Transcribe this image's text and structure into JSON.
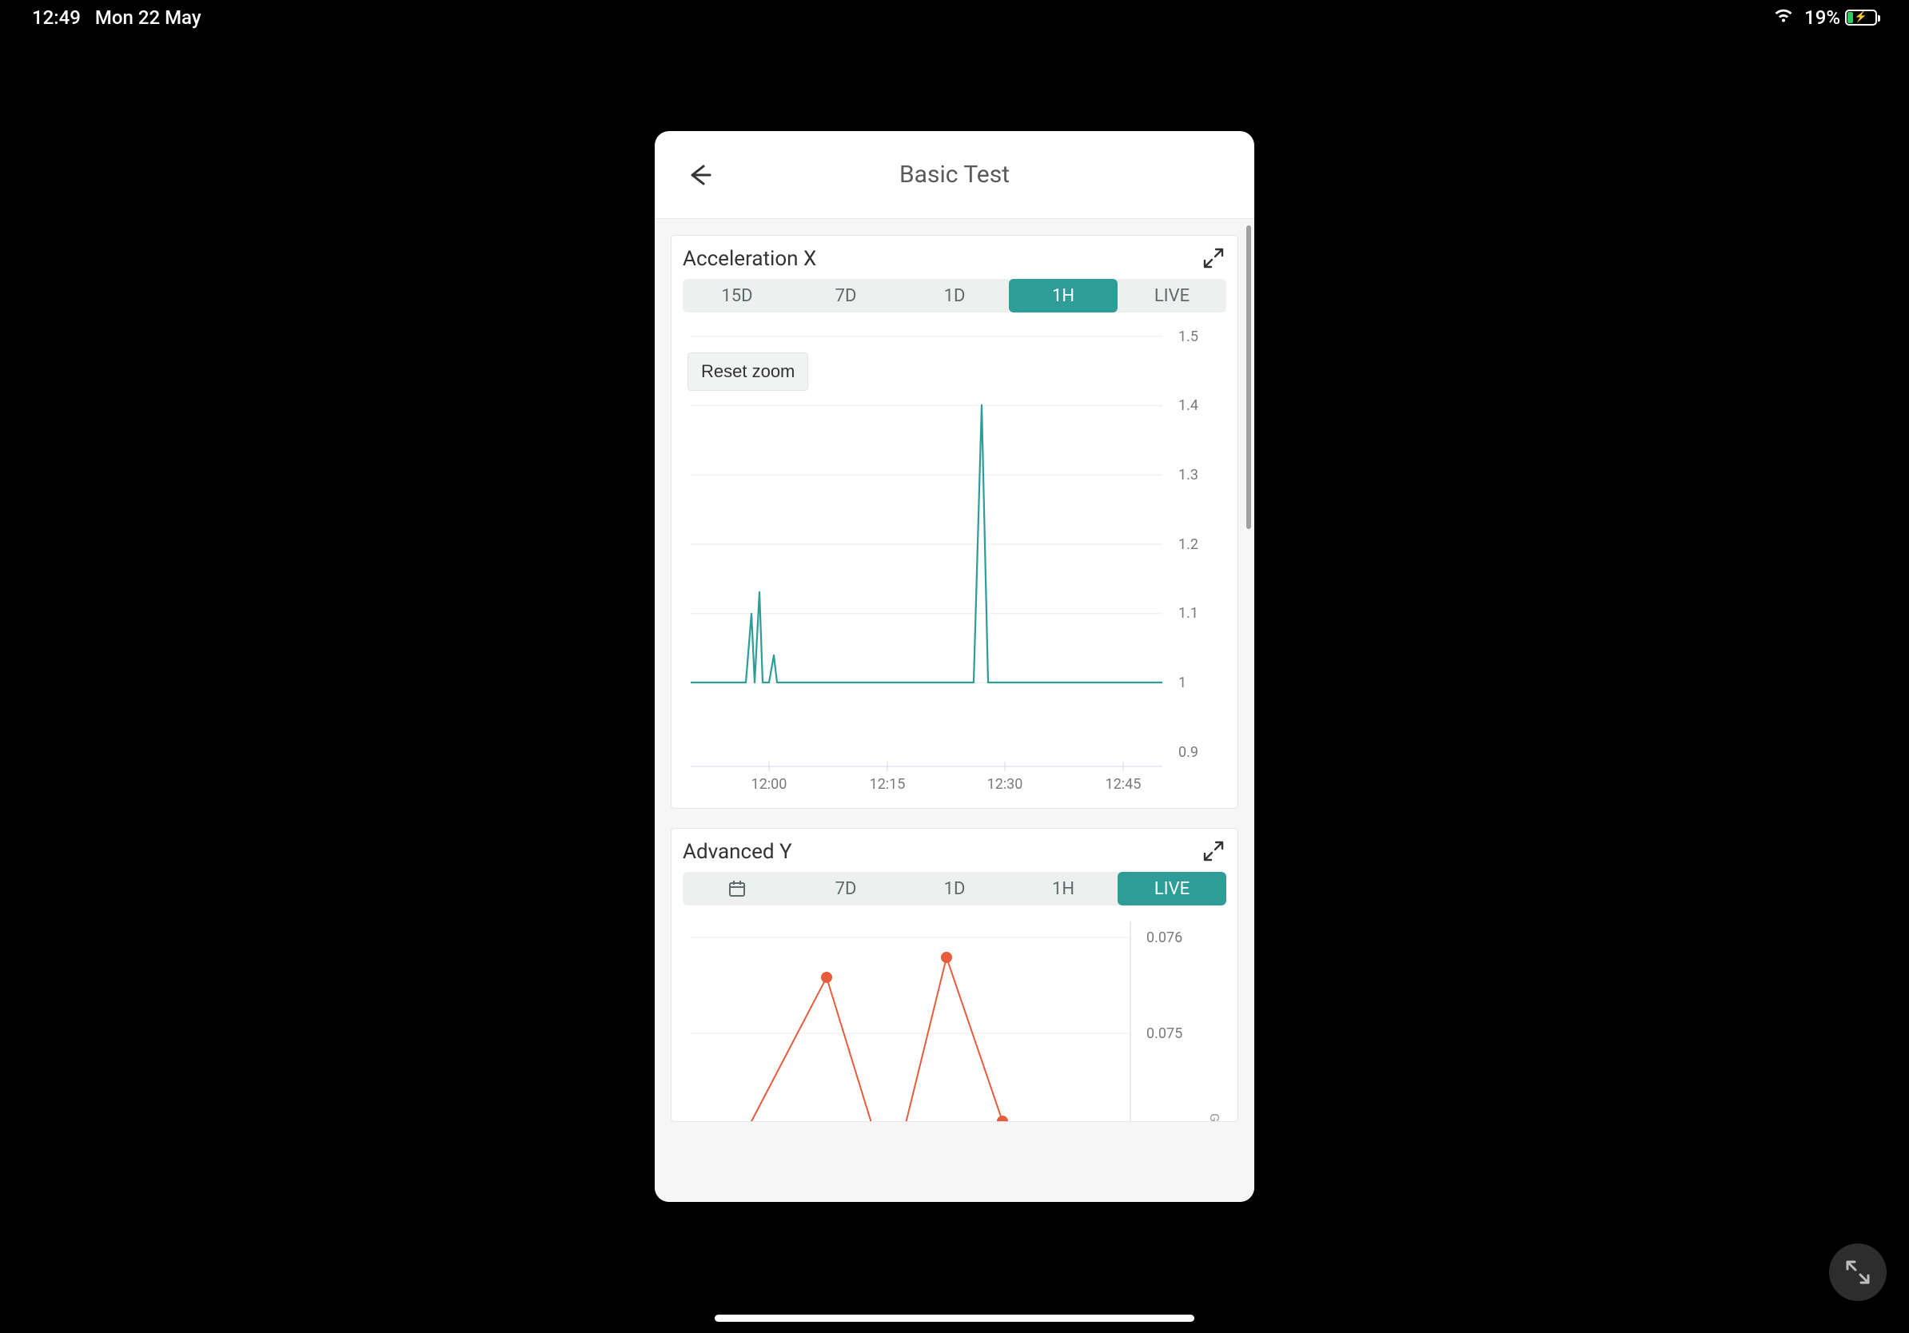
{
  "status_bar": {
    "time": "12:49",
    "date": "Mon 22 May",
    "battery_pct": "19%"
  },
  "header": {
    "title": "Basic Test"
  },
  "chart1": {
    "title": "Acceleration X",
    "reset_label": "Reset zoom",
    "segments": {
      "s0": "15D",
      "s1": "7D",
      "s2": "1D",
      "s3": "1H",
      "s4": "LIVE"
    },
    "active_segment": 3,
    "yticks": {
      "t0": "1.5",
      "t1": "1.4",
      "t2": "1.3",
      "t3": "1.2",
      "t4": "1.1",
      "t5": "1",
      "t6": "0.9"
    },
    "xticks": {
      "x0": "12:00",
      "x1": "12:15",
      "x2": "12:30",
      "x3": "12:45"
    }
  },
  "chart2": {
    "title": "Advanced Y",
    "segments": {
      "s1": "7D",
      "s2": "1D",
      "s3": "1H",
      "s4": "LIVE"
    },
    "active_segment": 4,
    "yticks": {
      "t0": "0.076",
      "t1": "0.075"
    },
    "unit": "G-F"
  },
  "chart_data": [
    {
      "type": "line",
      "title": "Acceleration X",
      "xlabel": "",
      "ylabel": "",
      "ylim": [
        0.9,
        1.5
      ],
      "x_range": [
        "11:50",
        "12:50"
      ],
      "x_ticks": [
        "12:00",
        "12:15",
        "12:30",
        "12:45"
      ],
      "y_ticks": [
        0.9,
        1.0,
        1.1,
        1.2,
        1.3,
        1.4,
        1.5
      ],
      "series": [
        {
          "name": "Acceleration X",
          "color": "#2e9c97",
          "note": "baseline ~1.0 across full hour; brief spikes at ~11:58 (~1.10), ~11:59 (~1.13), ~12:01 (~1.04), and a large spike at ~12:27 reaching ~1.40",
          "x": [
            "11:50",
            "11:57",
            "11:58",
            "11:58.5",
            "11:59",
            "11:59.5",
            "12:00",
            "12:00.5",
            "12:01",
            "12:05",
            "12:15",
            "12:26",
            "12:27",
            "12:28",
            "12:30",
            "12:45",
            "12:50"
          ],
          "y": [
            1.0,
            1.0,
            1.1,
            1.0,
            1.13,
            1.0,
            1.0,
            1.04,
            1.0,
            1.0,
            1.0,
            1.0,
            1.4,
            1.0,
            1.0,
            1.0,
            1.0
          ]
        }
      ]
    },
    {
      "type": "line",
      "title": "Advanced Y",
      "xlabel": "",
      "ylabel": "G-F",
      "ylim": [
        0.0735,
        0.0765
      ],
      "y_ticks": [
        0.075,
        0.076
      ],
      "series": [
        {
          "name": "Advanced Y",
          "color": "#e75c3c",
          "x": [
            0,
            1,
            2,
            3
          ],
          "y": [
            0.074,
            0.0755,
            0.0757,
            0.0738
          ]
        }
      ]
    }
  ]
}
